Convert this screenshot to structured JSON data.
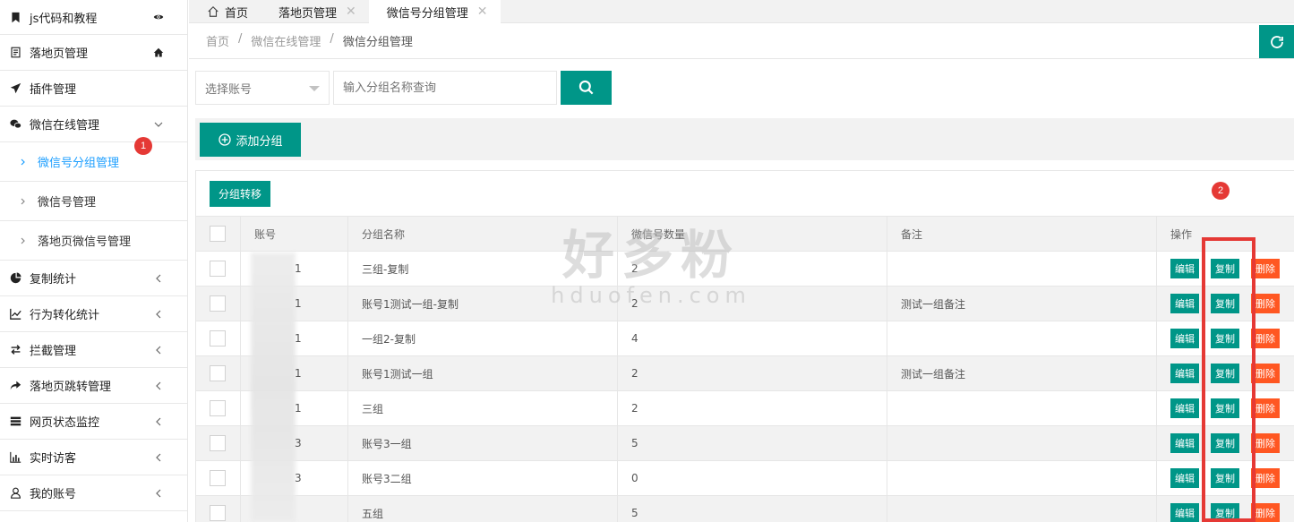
{
  "sidebar": {
    "items": [
      {
        "label": "js代码和教程",
        "icon": "bookmark-icon",
        "right_icon": "eye-icon"
      },
      {
        "label": "落地页管理",
        "icon": "document-icon",
        "right_icon": "home-icon"
      },
      {
        "label": "插件管理",
        "icon": "send-icon",
        "right_icon": ""
      },
      {
        "label": "微信在线管理",
        "icon": "wechat-icon",
        "right_icon": "chevron-down-icon"
      },
      {
        "label": "复制统计",
        "icon": "pie-chart-icon",
        "right_icon": "chevron-left-icon"
      },
      {
        "label": "行为转化统计",
        "icon": "line-chart-icon",
        "right_icon": "chevron-left-icon"
      },
      {
        "label": "拦截管理",
        "icon": "exchange-icon",
        "right_icon": "chevron-left-icon"
      },
      {
        "label": "落地页跳转管理",
        "icon": "share-icon",
        "right_icon": "chevron-left-icon"
      },
      {
        "label": "网页状态监控",
        "icon": "server-icon",
        "right_icon": "chevron-left-icon"
      },
      {
        "label": "实时访客",
        "icon": "bar-chart-icon",
        "right_icon": "chevron-left-icon"
      },
      {
        "label": "我的账号",
        "icon": "user-icon",
        "right_icon": "chevron-left-icon"
      }
    ],
    "subitems": [
      {
        "label": "微信号分组管理",
        "active": true
      },
      {
        "label": "微信号管理",
        "active": false
      },
      {
        "label": "落地页微信号管理",
        "active": false
      }
    ],
    "badge_1": "1"
  },
  "tabs": [
    {
      "label": "首页",
      "closable": false
    },
    {
      "label": "落地页管理",
      "closable": true
    },
    {
      "label": "微信号分组管理",
      "closable": true
    }
  ],
  "tab_close": "✕",
  "breadcrumb": {
    "items": [
      "首页",
      "微信在线管理",
      "微信分组管理"
    ],
    "sep": "/"
  },
  "filters": {
    "account_select": "选择账号",
    "search_placeholder": "输入分组名称查询"
  },
  "toolbar": {
    "add_label": "添加分组",
    "transfer_label": "分组转移"
  },
  "badge_2": "2",
  "table": {
    "headers": [
      "账号",
      "分组名称",
      "微信号数量",
      "备注",
      "操作"
    ],
    "rows": [
      {
        "account": "1",
        "name": "三组-复制",
        "count": "2",
        "note": ""
      },
      {
        "account": "1",
        "name": "账号1测试一组-复制",
        "count": "2",
        "note": "测试一组备注"
      },
      {
        "account": "1",
        "name": "一组2-复制",
        "count": "4",
        "note": ""
      },
      {
        "account": "1",
        "name": "账号1测试一组",
        "count": "2",
        "note": "测试一组备注"
      },
      {
        "account": "1",
        "name": "三组",
        "count": "2",
        "note": ""
      },
      {
        "account": "3",
        "name": "账号3一组",
        "count": "5",
        "note": ""
      },
      {
        "account": "3",
        "name": "账号3二组",
        "count": "0",
        "note": ""
      },
      {
        "account": "",
        "name": "五组",
        "count": "5",
        "note": ""
      }
    ],
    "actions": {
      "edit": "编辑",
      "copy": "复制",
      "delete": "删除"
    }
  },
  "watermark": {
    "big": "好多粉",
    "small": "hduofen.com"
  },
  "colors": {
    "primary": "#009688",
    "danger": "#ff5722",
    "highlight": "#e53935",
    "active_link": "#1e9fff"
  }
}
